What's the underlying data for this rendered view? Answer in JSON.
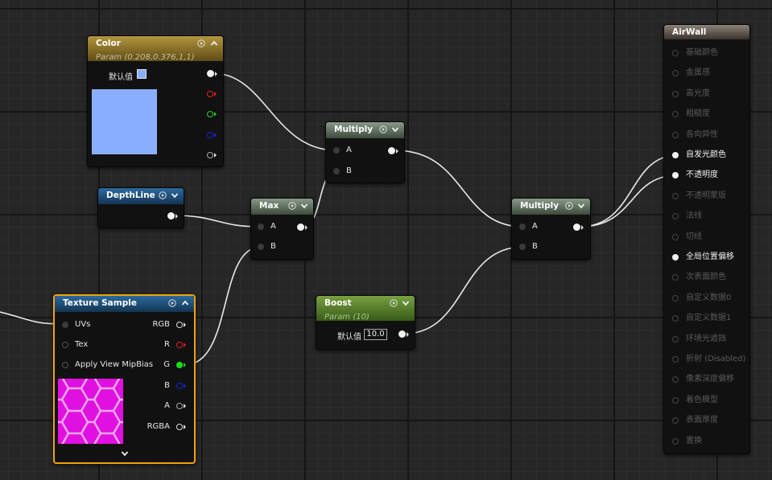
{
  "nodes": {
    "color": {
      "title": "Color",
      "subtitle": "Param (0.208,0.376,1,1)",
      "default_label": "默认值",
      "swatch_color": "#8aaeff"
    },
    "depthline": {
      "title": "DepthLine"
    },
    "max": {
      "title": "Max",
      "pin_a": "A",
      "pin_b": "B"
    },
    "multiply1": {
      "title": "Multiply",
      "pin_a": "A",
      "pin_b": "B"
    },
    "multiply2": {
      "title": "Multiply",
      "pin_a": "A",
      "pin_b": "B"
    },
    "boost": {
      "title": "Boost",
      "subtitle": "Param (10)",
      "default_label": "默认值",
      "value": "10.0"
    },
    "texture_sample": {
      "title": "Texture Sample",
      "inputs": [
        "UVs",
        "Tex",
        "Apply View MipBias"
      ],
      "outputs": [
        "RGB",
        "R",
        "G",
        "B",
        "A",
        "RGBA"
      ],
      "preview_color": "#e010e0"
    },
    "airwall": {
      "title": "AirWall",
      "items": [
        {
          "label": "基础颜色",
          "active": false
        },
        {
          "label": "金属感",
          "active": false
        },
        {
          "label": "高光度",
          "active": false
        },
        {
          "label": "粗糙度",
          "active": false
        },
        {
          "label": "各向异性",
          "active": false
        },
        {
          "label": "自发光颜色",
          "active": true
        },
        {
          "label": "不透明度",
          "active": true
        },
        {
          "label": "不透明蒙版",
          "active": false
        },
        {
          "label": "法线",
          "active": false
        },
        {
          "label": "切线",
          "active": false
        },
        {
          "label": "全局位置偏移",
          "active": true
        },
        {
          "label": "次表面颜色",
          "active": false
        },
        {
          "label": "自定义数据0",
          "active": false
        },
        {
          "label": "自定义数据1",
          "active": false
        },
        {
          "label": "环境光遮挡",
          "active": false
        },
        {
          "label": "折射 (Disabled)",
          "active": false
        },
        {
          "label": "像素深度偏移",
          "active": false
        },
        {
          "label": "着色模型",
          "active": false
        },
        {
          "label": "表面厚度",
          "active": false
        },
        {
          "label": "置换",
          "active": false
        }
      ]
    }
  }
}
